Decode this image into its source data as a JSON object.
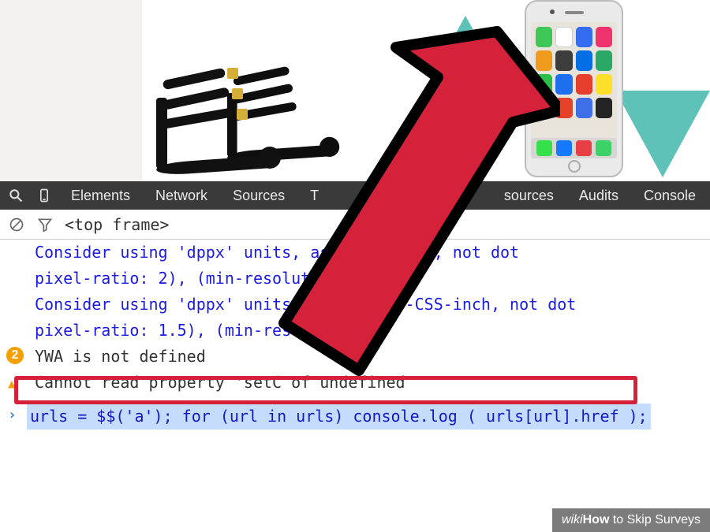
{
  "devtools": {
    "tabs": {
      "elements": "Elements",
      "network": "Network",
      "sources": "Sources",
      "timeline_partial": "T",
      "resources_partial": "sources",
      "audits": "Audits",
      "console": "Console"
    },
    "icons": {
      "search": "search-icon",
      "device": "device-toggle-icon",
      "clear": "clear-console-icon",
      "filter": "filter-icon"
    }
  },
  "console": {
    "frame_selector": "<top frame>",
    "messages": {
      "line1": "Consider using 'dppx' units, as                      r-CSS-inch, not dot",
      "line2": "pixel-ratio: 2), (min-resoluti",
      "line3": "Consider using 'dppx' units,                   s dots-per-CSS-inch, not dot",
      "line4": "pixel-ratio: 1.5), (min-reso",
      "warn1_count": "2",
      "warn1": "YWA is not defined",
      "warn2": "Cannot read property 'setC     of undefined"
    },
    "input": "urls = $$('a'); for (url in urls) console.log ( urls[url].href );"
  },
  "watermark": {
    "brand": "wiki",
    "how": "How",
    "text": " to Skip Surveys"
  }
}
